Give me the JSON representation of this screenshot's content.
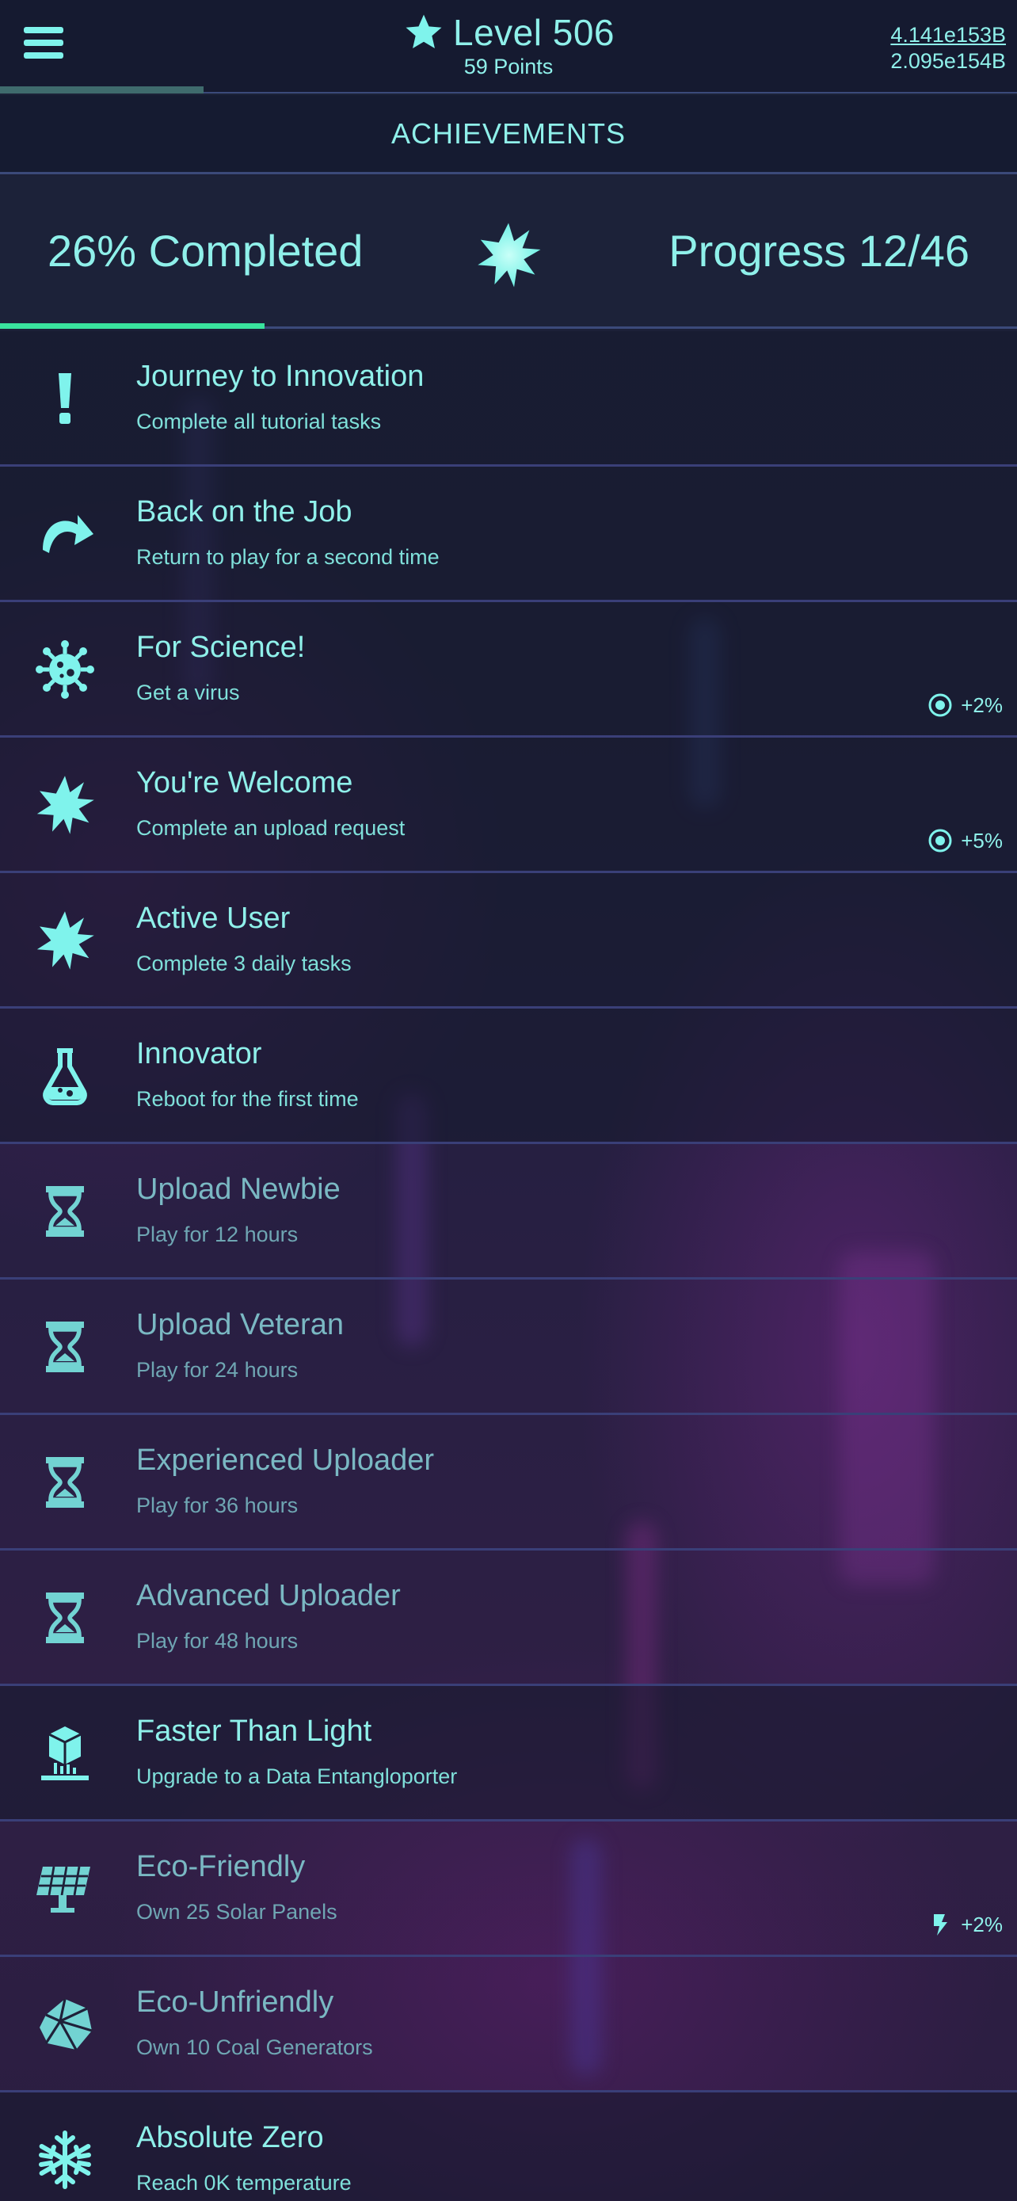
{
  "header": {
    "level": "Level 506",
    "points": "59 Points",
    "currency_primary": "4.141e153B",
    "currency_secondary": "2.095e154B",
    "xp_progress": 0.2
  },
  "section_title": "ACHIEVEMENTS",
  "summary": {
    "completed_text": "26% Completed",
    "progress_text": "Progress 12/46",
    "completed_fraction": 0.26
  },
  "achievements": [
    {
      "icon": "exclamation-icon",
      "title": "Journey to Innovation",
      "desc": "Complete all tutorial tasks",
      "state": "done",
      "bonus": ""
    },
    {
      "icon": "redo-arrow-icon",
      "title": "Back on the Job",
      "desc": "Return to play for a second time",
      "state": "done",
      "bonus": ""
    },
    {
      "icon": "virus-icon",
      "title": "For Science!",
      "desc": "Get a virus",
      "state": "done",
      "bonus": "+2%",
      "bonus_icon": "cycle-icon"
    },
    {
      "icon": "starburst-icon",
      "title": "You're Welcome",
      "desc": "Complete an upload request",
      "state": "done",
      "bonus": "+5%",
      "bonus_icon": "cycle-icon"
    },
    {
      "icon": "starburst-icon",
      "title": "Active User",
      "desc": "Complete 3 daily tasks",
      "state": "done",
      "bonus": ""
    },
    {
      "icon": "flask-icon",
      "title": "Innovator",
      "desc": "Reboot for the first time",
      "state": "done",
      "bonus": ""
    },
    {
      "icon": "hourglass-icon",
      "title": "Upload Newbie",
      "desc": "Play for 12 hours",
      "state": "locked",
      "bonus": ""
    },
    {
      "icon": "hourglass-icon",
      "title": "Upload Veteran",
      "desc": "Play for 24 hours",
      "state": "locked",
      "bonus": ""
    },
    {
      "icon": "hourglass-icon",
      "title": "Experienced Uploader",
      "desc": "Play for 36 hours",
      "state": "locked",
      "bonus": ""
    },
    {
      "icon": "hourglass-icon",
      "title": "Advanced Uploader",
      "desc": "Play for 48 hours",
      "state": "locked",
      "bonus": ""
    },
    {
      "icon": "entangloporter-icon",
      "title": "Faster Than Light",
      "desc": "Upgrade to a Data Entangloporter",
      "state": "done",
      "bonus": ""
    },
    {
      "icon": "solar-panel-icon",
      "title": "Eco-Friendly",
      "desc": "Own 25 Solar Panels",
      "state": "locked",
      "bonus": "+2%",
      "bonus_icon": "lightning-icon"
    },
    {
      "icon": "coal-icon",
      "title": "Eco-Unfriendly",
      "desc": "Own 10 Coal Generators",
      "state": "locked",
      "bonus": ""
    },
    {
      "icon": "snowflake-icon",
      "title": "Absolute Zero",
      "desc": "Reach 0K temperature",
      "state": "done",
      "bonus": ""
    }
  ],
  "colors": {
    "accent": "#8ff0ea",
    "progress_green": "#39e39e",
    "divider": "#3a3f78"
  }
}
